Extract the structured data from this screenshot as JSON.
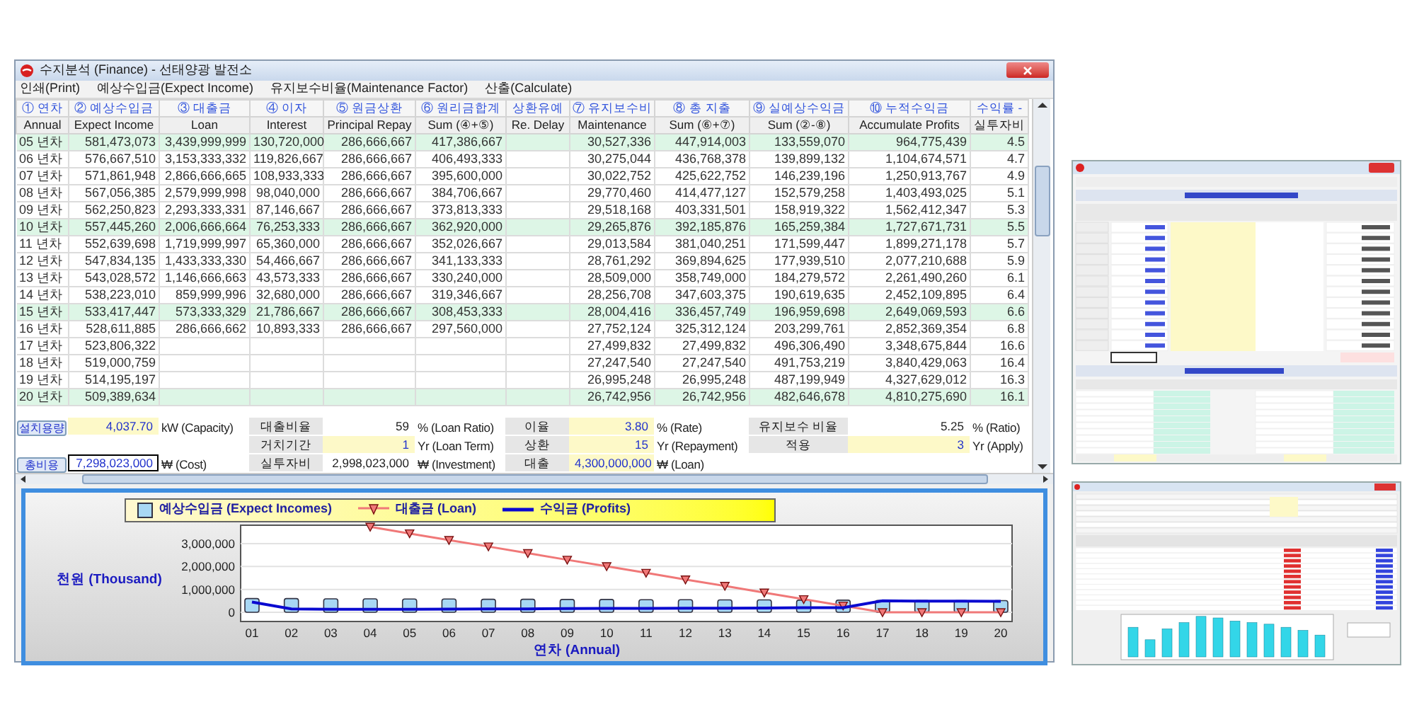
{
  "window": {
    "title": "수지분석 (Finance) - 선태양광 발전소"
  },
  "menu": [
    {
      "label": "인쇄(Print)"
    },
    {
      "label": "예상수입금(Expect Income)"
    },
    {
      "label": "유지보수비율(Maintenance Factor)"
    },
    {
      "label": "산출(Calculate)"
    }
  ],
  "table": {
    "columns": [
      {
        "title": "① 연차",
        "subtitle": "Annual"
      },
      {
        "title": "② 예상수입금",
        "subtitle": "Expect Income"
      },
      {
        "title": "③ 대출금",
        "subtitle": "Loan"
      },
      {
        "title": "④ 이자",
        "subtitle": "Interest"
      },
      {
        "title": "⑤ 원금상환",
        "subtitle": "Principal Repay"
      },
      {
        "title": "⑥ 원리금합계",
        "subtitle": "Sum (④+⑤)"
      },
      {
        "title": "상환유예",
        "subtitle": "Re. Delay"
      },
      {
        "title": "⑦ 유지보수비",
        "subtitle": "Maintenance"
      },
      {
        "title": "⑧ 총 지출",
        "subtitle": "Sum (⑥+⑦)"
      },
      {
        "title": "⑨ 실예상수익금",
        "subtitle": "Sum (②-⑧)"
      },
      {
        "title": "⑩ 누적수익금",
        "subtitle": "Accumulate Profits"
      },
      {
        "title": "수익률 -",
        "subtitle": "실투자비"
      }
    ],
    "rows": [
      {
        "highlighted": true,
        "cells": [
          "05 년차",
          "581,473,073",
          "3,439,999,999",
          "130,720,000",
          "286,666,667",
          "417,386,667",
          null,
          "30,527,336",
          "447,914,003",
          "133,559,070",
          "964,775,439",
          "4.5"
        ]
      },
      {
        "highlighted": false,
        "cells": [
          "06 년차",
          "576,667,510",
          "3,153,333,332",
          "119,826,667",
          "286,666,667",
          "406,493,333",
          null,
          "30,275,044",
          "436,768,378",
          "139,899,132",
          "1,104,674,571",
          "4.7"
        ]
      },
      {
        "highlighted": false,
        "cells": [
          "07 년차",
          "571,861,948",
          "2,866,666,665",
          "108,933,333",
          "286,666,667",
          "395,600,000",
          null,
          "30,022,752",
          "425,622,752",
          "146,239,196",
          "1,250,913,767",
          "4.9"
        ]
      },
      {
        "highlighted": false,
        "cells": [
          "08 년차",
          "567,056,385",
          "2,579,999,998",
          "98,040,000",
          "286,666,667",
          "384,706,667",
          null,
          "29,770,460",
          "414,477,127",
          "152,579,258",
          "1,403,493,025",
          "5.1"
        ]
      },
      {
        "highlighted": false,
        "cells": [
          "09 년차",
          "562,250,823",
          "2,293,333,331",
          "87,146,667",
          "286,666,667",
          "373,813,333",
          null,
          "29,518,168",
          "403,331,501",
          "158,919,322",
          "1,562,412,347",
          "5.3"
        ]
      },
      {
        "highlighted": true,
        "cells": [
          "10 년차",
          "557,445,260",
          "2,006,666,664",
          "76,253,333",
          "286,666,667",
          "362,920,000",
          null,
          "29,265,876",
          "392,185,876",
          "165,259,384",
          "1,727,671,731",
          "5.5"
        ]
      },
      {
        "highlighted": false,
        "cells": [
          "11 년차",
          "552,639,698",
          "1,719,999,997",
          "65,360,000",
          "286,666,667",
          "352,026,667",
          null,
          "29,013,584",
          "381,040,251",
          "171,599,447",
          "1,899,271,178",
          "5.7"
        ]
      },
      {
        "highlighted": false,
        "cells": [
          "12 년차",
          "547,834,135",
          "1,433,333,330",
          "54,466,667",
          "286,666,667",
          "341,133,333",
          null,
          "28,761,292",
          "369,894,625",
          "177,939,510",
          "2,077,210,688",
          "5.9"
        ]
      },
      {
        "highlighted": false,
        "cells": [
          "13 년차",
          "543,028,572",
          "1,146,666,663",
          "43,573,333",
          "286,666,667",
          "330,240,000",
          null,
          "28,509,000",
          "358,749,000",
          "184,279,572",
          "2,261,490,260",
          "6.1"
        ]
      },
      {
        "highlighted": false,
        "cells": [
          "14 년차",
          "538,223,010",
          "859,999,996",
          "32,680,000",
          "286,666,667",
          "319,346,667",
          null,
          "28,256,708",
          "347,603,375",
          "190,619,635",
          "2,452,109,895",
          "6.4"
        ]
      },
      {
        "highlighted": true,
        "cells": [
          "15 년차",
          "533,417,447",
          "573,333,329",
          "21,786,667",
          "286,666,667",
          "308,453,333",
          null,
          "28,004,416",
          "336,457,749",
          "196,959,698",
          "2,649,069,593",
          "6.6"
        ]
      },
      {
        "highlighted": false,
        "cells": [
          "16 년차",
          "528,611,885",
          "286,666,662",
          "10,893,333",
          "286,666,667",
          "297,560,000",
          null,
          "27,752,124",
          "325,312,124",
          "203,299,761",
          "2,852,369,354",
          "6.8"
        ]
      },
      {
        "highlighted": false,
        "cells": [
          "17 년차",
          "523,806,322",
          null,
          null,
          null,
          null,
          null,
          "27,499,832",
          "27,499,832",
          "496,306,490",
          "3,348,675,844",
          "16.6"
        ]
      },
      {
        "highlighted": false,
        "cells": [
          "18 년차",
          "519,000,759",
          null,
          null,
          null,
          null,
          null,
          "27,247,540",
          "27,247,540",
          "491,753,219",
          "3,840,429,063",
          "16.4"
        ]
      },
      {
        "highlighted": false,
        "cells": [
          "19 년차",
          "514,195,197",
          null,
          null,
          null,
          null,
          null,
          "26,995,248",
          "26,995,248",
          "487,199,949",
          "4,327,629,012",
          "16.3"
        ]
      },
      {
        "highlighted": true,
        "cells": [
          "20 년차",
          "509,389,634",
          null,
          null,
          null,
          null,
          null,
          "26,742,956",
          "26,742,956",
          "482,646,678",
          "4,810,275,690",
          "16.1"
        ]
      }
    ]
  },
  "settings": {
    "rows": [
      {
        "cells": [
          {
            "kind": "button",
            "text": "설치용량"
          },
          {
            "kind": "field",
            "text": "4,037.70",
            "editable": true,
            "focused": false
          },
          {
            "kind": "unit",
            "text": "kW (Capacity)"
          },
          {
            "kind": "label",
            "text": "대출비율"
          },
          {
            "kind": "field",
            "text": "59",
            "editable": false,
            "focused": false
          },
          {
            "kind": "unit",
            "text": "% (Loan Ratio)"
          },
          {
            "kind": "label",
            "text": "이율"
          },
          {
            "kind": "field",
            "text": "3.80",
            "editable": true,
            "focused": false
          },
          {
            "kind": "unit",
            "text": "% (Rate)"
          },
          {
            "kind": "label",
            "text": "유지보수 비율"
          },
          {
            "kind": "field",
            "text": "5.25",
            "editable": false,
            "focused": false
          },
          {
            "kind": "unit",
            "text": "% (Ratio)"
          }
        ]
      },
      {
        "cells": [
          {
            "kind": "blank"
          },
          {
            "kind": "blank"
          },
          {
            "kind": "blank"
          },
          {
            "kind": "label",
            "text": "거치기간"
          },
          {
            "kind": "field",
            "text": "1",
            "editable": true,
            "focused": false
          },
          {
            "kind": "unit",
            "text": "Yr (Loan Term)"
          },
          {
            "kind": "label",
            "text": "상환"
          },
          {
            "kind": "field",
            "text": "15",
            "editable": true,
            "focused": false
          },
          {
            "kind": "unit",
            "text": "Yr (Repayment)"
          },
          {
            "kind": "label",
            "text": "적용"
          },
          {
            "kind": "field",
            "text": "3",
            "editable": true,
            "focused": false
          },
          {
            "kind": "unit",
            "text": "Yr (Apply)"
          }
        ]
      },
      {
        "cells": [
          {
            "kind": "button",
            "text": "총비용"
          },
          {
            "kind": "field",
            "text": "7,298,023,000",
            "editable": false,
            "focused": true
          },
          {
            "kind": "unit",
            "text": "₩ (Cost)"
          },
          {
            "kind": "label",
            "text": "실투자비"
          },
          {
            "kind": "field",
            "text": "2,998,023,000",
            "editable": false,
            "focused": false
          },
          {
            "kind": "unit",
            "text": "₩ (Investment)"
          },
          {
            "kind": "label",
            "text": "대출"
          },
          {
            "kind": "field",
            "text": "4,300,000,000",
            "editable": true,
            "focused": false
          },
          {
            "kind": "unit",
            "text": "₩ (Loan)"
          },
          {
            "kind": "blank"
          },
          {
            "kind": "blank"
          },
          {
            "kind": "blank"
          }
        ]
      }
    ]
  },
  "chart": {
    "chart_data": {
      "type": "bar",
      "grid": true,
      "xlabel": "연차 (Annual)",
      "ylabel": "천원 (Thousand)",
      "categories": [
        "01",
        "02",
        "03",
        "04",
        "05",
        "06",
        "07",
        "08",
        "09",
        "10",
        "11",
        "12",
        "13",
        "14",
        "15",
        "16",
        "17",
        "18",
        "19",
        "20"
      ],
      "series": [
        {
          "name": "예상수입금 (Expect Incomes)",
          "type": "bar",
          "color": "#a8d8f4",
          "values": [
            600000,
            600000,
            590000,
            590000,
            580000,
            580000,
            570000,
            570000,
            560000,
            560000,
            550000,
            550000,
            540000,
            540000,
            530000,
            530000,
            520000,
            520000,
            510000,
            510000
          ]
        },
        {
          "name": "대출금 (Loan)",
          "type": "line",
          "marker": "triangle",
          "color": "#f07878",
          "values": [
            null,
            null,
            null,
            3730000,
            3440000,
            3150000,
            2870000,
            2580000,
            2290000,
            2010000,
            1720000,
            1430000,
            1150000,
            860000,
            570000,
            290000,
            0,
            0,
            0,
            0
          ]
        },
        {
          "name": "수익금 (Profits)",
          "type": "line",
          "color": "#0a0ad0",
          "values": [
            450000,
            150000,
            130000,
            130000,
            130000,
            140000,
            150000,
            150000,
            160000,
            170000,
            170000,
            180000,
            180000,
            190000,
            200000,
            200000,
            500000,
            490000,
            490000,
            480000
          ]
        }
      ],
      "ylim": [
        -400000,
        3800000
      ],
      "yticks": [
        {
          "value": 0,
          "label": "0"
        },
        {
          "value": 1000000,
          "label": "1,000,000"
        },
        {
          "value": 2000000,
          "label": "2,000,000"
        },
        {
          "value": 3000000,
          "label": "3,000,000"
        }
      ]
    }
  }
}
